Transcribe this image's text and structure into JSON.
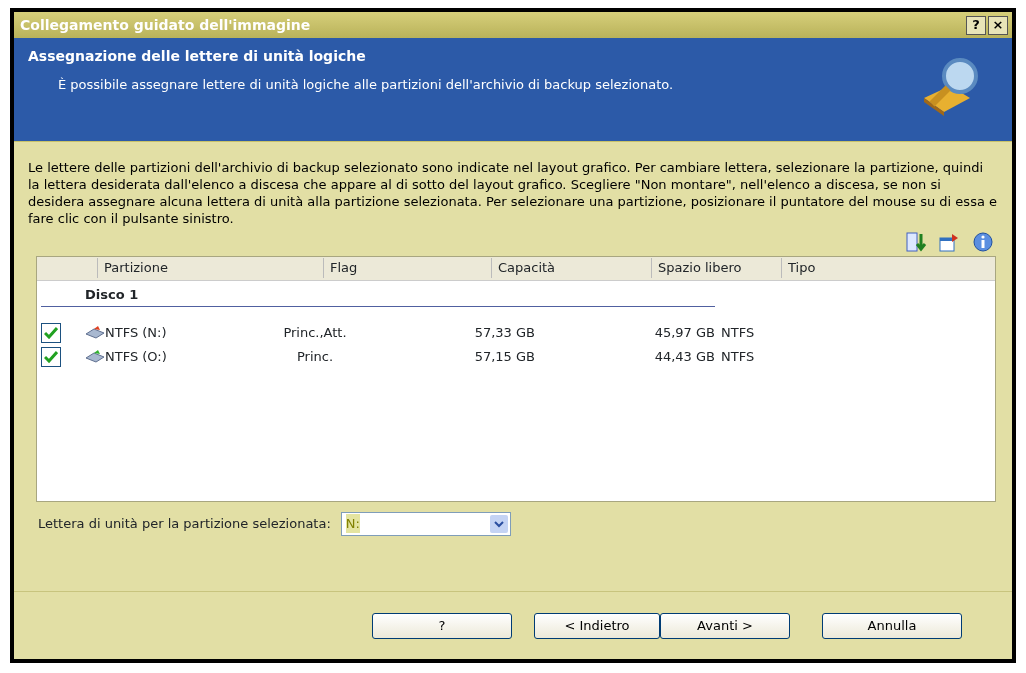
{
  "window": {
    "title": "Collegamento guidato dell'immagine",
    "controls": [
      "?",
      "×"
    ]
  },
  "header": {
    "title": "Assegnazione delle lettere di unità logiche",
    "subtitle": "È possibile assegnare lettere di unità logiche alle partizioni dell'archivio di backup selezionato."
  },
  "description": "Le lettere delle partizioni dell'archivio di backup selezionato sono indicate nel layout grafico. Per cambiare lettera, selezionare la partizione, quindi la lettera desiderata dall'elenco a discesa che appare al di sotto del layout grafico. Scegliere \"Non montare\", nell'elenco a discesa, se non si desidera assegnare alcuna lettera di unità alla partizione selezionata. Per selezionare una partizione, posizionare il puntatore del mouse su di essa e fare clic con il pulsante sinistro.",
  "table": {
    "columns": [
      "Partizione",
      "Flag",
      "Capacità",
      "Spazio libero",
      "Tipo"
    ],
    "groups": [
      {
        "name": "Disco 1",
        "rows": [
          {
            "checked": true,
            "partition": "NTFS (N:)",
            "flag": "Princ.,Att.",
            "capacity": "57,33 GB",
            "free": "45,97 GB",
            "type": "NTFS"
          },
          {
            "checked": true,
            "partition": "NTFS (O:)",
            "flag": "Princ.",
            "capacity": "57,15 GB",
            "free": "44,43 GB",
            "type": "NTFS"
          }
        ]
      }
    ]
  },
  "drive_letter": {
    "label": "Lettera di unità per la partizione selezionata:",
    "value": "N:"
  },
  "buttons": [
    "?",
    "< Indietro",
    "Avanti >",
    "Annulla"
  ]
}
